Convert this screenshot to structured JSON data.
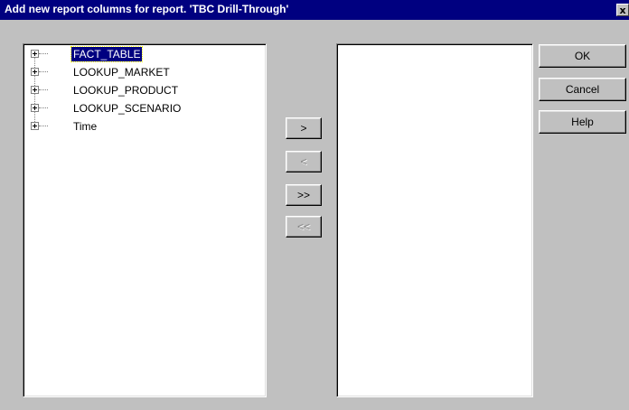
{
  "window": {
    "title": "Add new report columns for report. 'TBC Drill-Through'",
    "close_label": "x"
  },
  "tree": {
    "items": [
      {
        "label": "FACT_TABLE",
        "selected": true
      },
      {
        "label": "LOOKUP_MARKET",
        "selected": false
      },
      {
        "label": "LOOKUP_PRODUCT",
        "selected": false
      },
      {
        "label": "LOOKUP_SCENARIO",
        "selected": false
      },
      {
        "label": "Time",
        "selected": false
      }
    ]
  },
  "target_list": {
    "items": []
  },
  "move_buttons": {
    "add_label": ">",
    "remove_label": "<",
    "add_all_label": ">>",
    "remove_all_label": "<<"
  },
  "actions": {
    "ok_label": "OK",
    "cancel_label": "Cancel",
    "help_label": "Help"
  },
  "colors": {
    "face": "#c0c0c0",
    "titlebar": "#000080",
    "selection": "#000080"
  }
}
